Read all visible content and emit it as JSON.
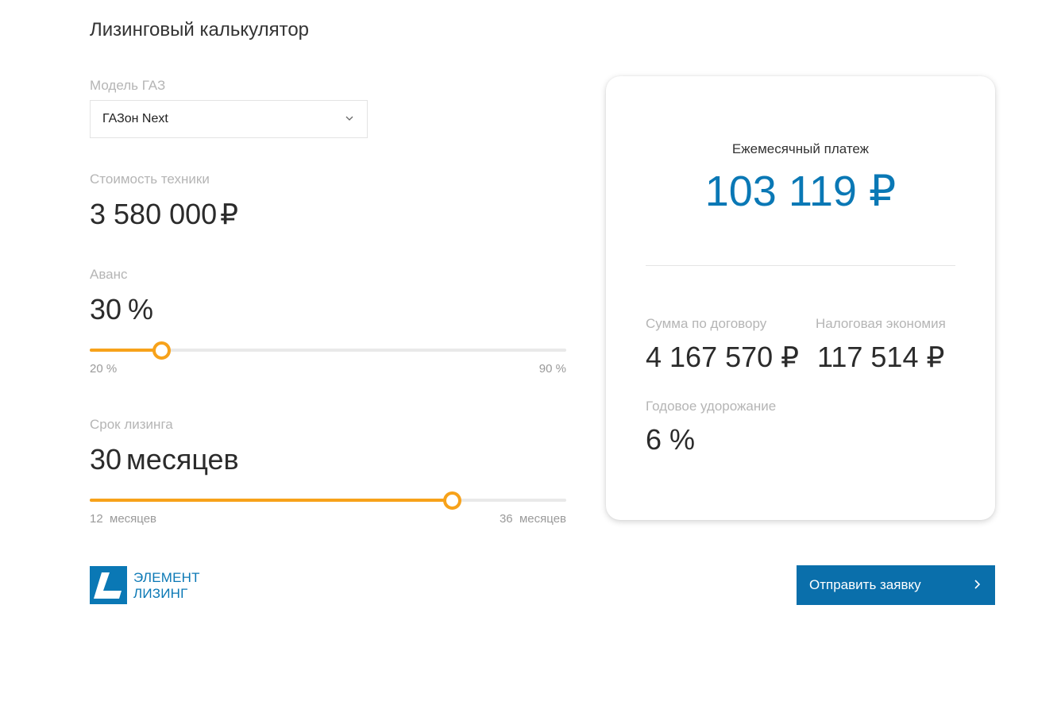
{
  "title": "Лизинговый калькулятор",
  "model": {
    "label": "Модель ГАЗ",
    "selected": "ГАЗон Next"
  },
  "cost": {
    "label": "Стоимость техники",
    "value": "3 580 000",
    "unit": "₽"
  },
  "advance": {
    "label": "Аванс",
    "value": "30",
    "unit": "%",
    "min_label": "20 %",
    "max_label": "90 %",
    "min": 20,
    "max": 90,
    "current": 30
  },
  "term": {
    "label": "Срок лизинга",
    "value": "30",
    "unit": "месяцев",
    "min_label": "12  месяцев",
    "max_label": "36  месяцев",
    "min": 12,
    "max": 36,
    "current": 30
  },
  "result": {
    "monthly_label": "Ежемесячный платеж",
    "monthly_value": "103 119 ₽",
    "contract_label": "Сумма по договору",
    "contract_value": "4 167 570 ₽",
    "tax_label": "Налоговая экономия",
    "tax_value": "117 514 ₽",
    "annual_label": "Годовое удорожание",
    "annual_value": "6 %"
  },
  "logo": {
    "line1": "ЭЛЕМЕНТ",
    "line2": "ЛИЗИНГ"
  },
  "submit_label": "Отправить заявку",
  "colors": {
    "accent": "#f7a21a",
    "brand": "#0a78b5"
  }
}
